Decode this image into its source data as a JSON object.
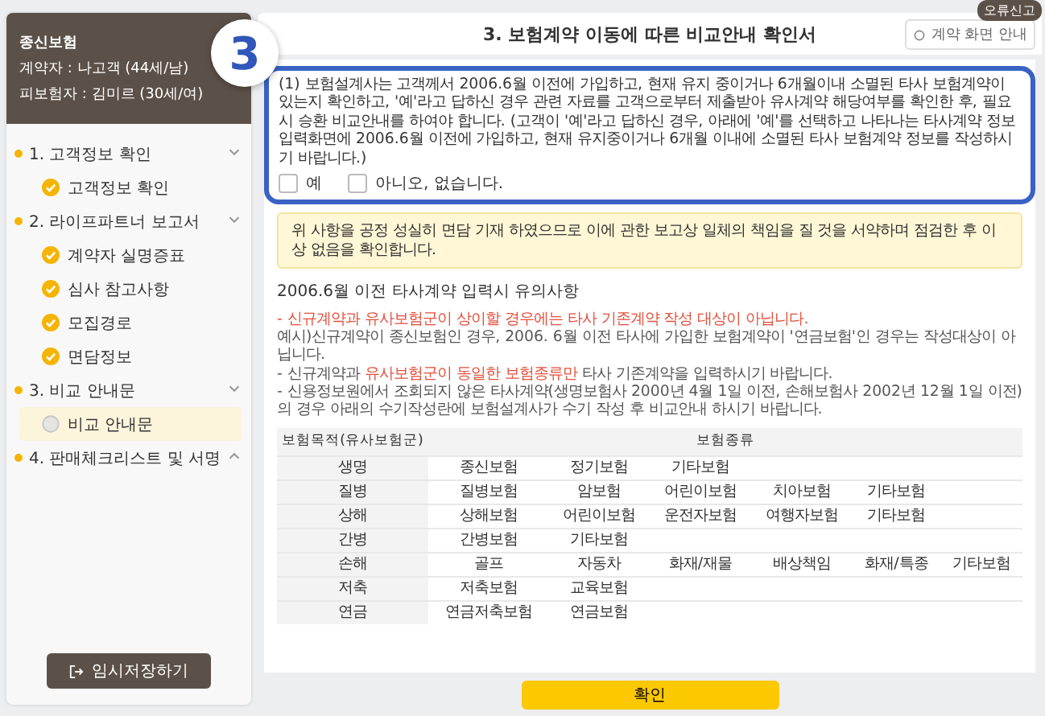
{
  "sidebar": {
    "product": "종신보험",
    "lines": [
      "계약자 : 나고객 (44세/남)",
      "피보험자 : 김미르 (30세/여)"
    ],
    "sections": [
      {
        "label": "1. 고객정보 확인",
        "expanded": true,
        "children": [
          {
            "label": "고객정보 확인",
            "done": true,
            "selected": false
          }
        ]
      },
      {
        "label": "2. 라이프파트너 보고서",
        "expanded": true,
        "children": [
          {
            "label": "계약자 실명증표",
            "done": true,
            "selected": false
          },
          {
            "label": "심사 참고사항",
            "done": true,
            "selected": false
          },
          {
            "label": "모집경로",
            "done": true,
            "selected": false
          },
          {
            "label": "면담정보",
            "done": true,
            "selected": false
          }
        ]
      },
      {
        "label": "3. 비교 안내문",
        "expanded": true,
        "children": [
          {
            "label": "비교 안내문",
            "done": false,
            "selected": true
          }
        ]
      },
      {
        "label": "4. 판매체크리스트 및 서명",
        "expanded": false
      }
    ],
    "save_button": "임시저장하기"
  },
  "header": {
    "title": "3. 보험계약 이동에 따른 비교안내 확인서",
    "guide_button": "계약 화면 안내",
    "badge": "오류신고"
  },
  "step_marker": {
    "label": "3"
  },
  "question": {
    "text": "(1) 보험설계사는 고객께서 2006.6월 이전에 가입하고, 현재 유지 중이거나 6개월이내 소멸된 타사 보험계약이 있는지 확인하고, '예'라고 답하신 경우 관련 자료를 고객으로부터 제출받아 유사계약 해당여부를 확인한 후, 필요시 승환 비교안내를 하여야 합니다. (고객이 '예'라고 답하신 경우, 아래에 '예'를 선택하고 나타나는 타사계약 정보 입력화면에 2006.6월 이전에 가입하고, 현재 유지중이거나 6개월 이내에 소멸된 타사 보험계약 정보를 작성하시기 바랍니다.)",
    "options": [
      {
        "label": "예",
        "checked": false
      },
      {
        "label": "아니오, 없습니다.",
        "checked": false
      }
    ]
  },
  "notice": "위 사항을 공정 성실히 면담 기재 하였으므로 이에 관한 보고상 일체의 책임을 질 것을 서약하며 점검한 후 이상 없음을 확인합니다.",
  "notes": {
    "title": "2006.6월 이전 타사계약 입력시 유의사항",
    "items": [
      {
        "parts": [
          {
            "text": "- 신규계약과 유사보험군이 상이할 경우에는 타사 기존계약 작성 대상이 아닙니다.",
            "highlight": true
          }
        ]
      },
      {
        "parts": [
          {
            "text": "예시)신규계약이 종신보험인 경우, 2006. 6월 이전 타사에 가입한 보험계약이 '연금보험'인 경우는 작성대상이 아닙니다.",
            "highlight": false
          }
        ]
      },
      {
        "parts": [
          {
            "text": "- 신규계약과 ",
            "highlight": false
          },
          {
            "text": "유사보험군이 동일한 보험종류만",
            "highlight": true
          },
          {
            "text": " 타사 기존계약을 입력하시기 바랍니다.",
            "highlight": false
          }
        ]
      },
      {
        "parts": [
          {
            "text": "- 신용정보원에서 조회되지 않은 타사계약(생명보험사 2000년 4월 1일 이전, 손해보험사 2002년 12월 1일 이전)의 경우 아래의 수기작성란에 보험설계사가 수기 작성 후 비교안내 하시기 바랍니다.",
            "highlight": false
          }
        ]
      }
    ]
  },
  "table": {
    "columns": [
      "보험목적(유사보험군)",
      "보험종류"
    ],
    "rows": [
      {
        "group": "생명",
        "types": [
          "종신보험",
          "정기보험",
          "기타보험"
        ]
      },
      {
        "group": "질병",
        "types": [
          "질병보험",
          "암보험",
          "어린이보험",
          "치아보험",
          "기타보험"
        ]
      },
      {
        "group": "상해",
        "types": [
          "상해보험",
          "어린이보험",
          "운전자보험",
          "여행자보험",
          "기타보험"
        ]
      },
      {
        "group": "간병",
        "types": [
          "간병보험",
          "기타보험"
        ]
      },
      {
        "group": "손해",
        "types": [
          "골프",
          "자동차",
          "화재/재물",
          "배상책임",
          "화재/특종",
          "기타보험"
        ]
      },
      {
        "group": "저축",
        "types": [
          "저축보험",
          "교육보험"
        ]
      },
      {
        "group": "연금",
        "types": [
          "연금저축보험",
          "연금보험"
        ]
      }
    ]
  },
  "confirm_button": "확인"
}
